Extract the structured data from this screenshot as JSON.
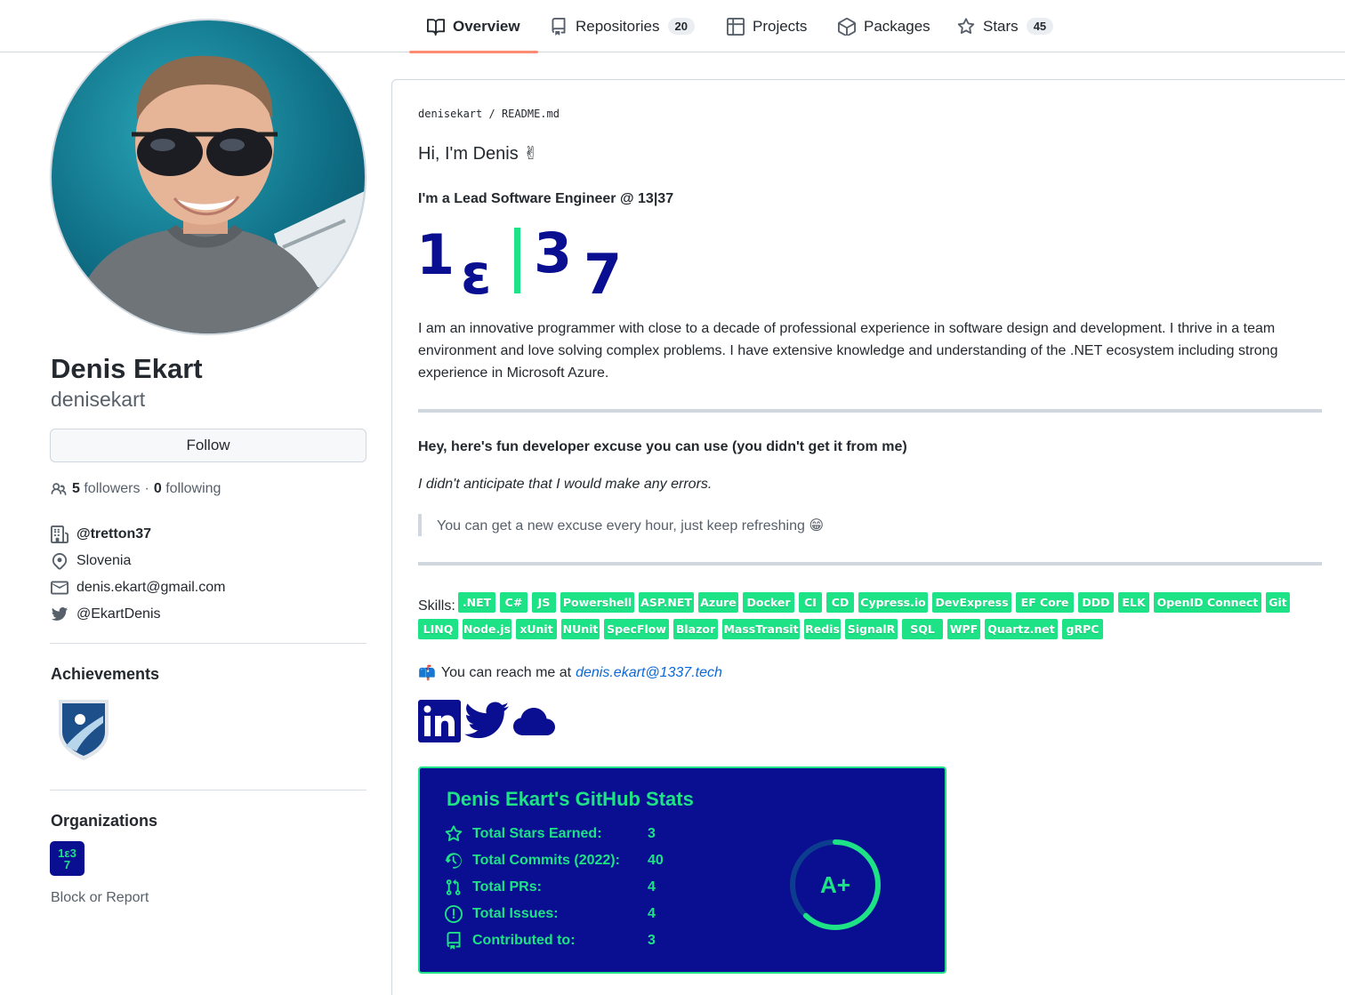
{
  "nav": {
    "tabs": [
      {
        "label": "Overview",
        "icon": "book-icon"
      },
      {
        "label": "Repositories",
        "count": "20",
        "icon": "repo-icon"
      },
      {
        "label": "Projects",
        "icon": "table-icon"
      },
      {
        "label": "Packages",
        "icon": "package-icon"
      },
      {
        "label": "Stars",
        "count": "45",
        "icon": "star-icon"
      }
    ]
  },
  "profile": {
    "name": "Denis Ekart",
    "login": "denisekart",
    "follow_label": "Follow",
    "followers_count": "5",
    "followers_label": "followers",
    "separator": "·",
    "following_count": "0",
    "following_label": "following",
    "company": "@tretton37",
    "location": "Slovenia",
    "email": "denis.ekart@gmail.com",
    "twitter": "@EkartDenis",
    "achievements_heading": "Achievements",
    "organizations_heading": "Organizations",
    "org_logo_text": "1ε37",
    "block_label": "Block or Report"
  },
  "readme": {
    "path_owner": "denisekart",
    "path_sep": "/",
    "path_file": "README.md",
    "greeting": "Hi, I'm Denis ✌",
    "role": "I'm a Lead Software Engineer @ 13|37",
    "logo_chars": [
      "1",
      "ε",
      "|",
      "3",
      "7"
    ],
    "bio": "I am an innovative programmer with close to a decade of professional experience in software design and development. I thrive in a team environment and love solving complex problems. I have extensive knowledge and understanding of the .NET ecosystem including strong experience in Microsoft Azure.",
    "excuse_heading": "Hey, here's fun developer excuse you can use (you didn't get it from me)",
    "excuse": "I didn't anticipate that I would make any errors.",
    "quote": "You can get a new excuse every hour, just keep refreshing 😁",
    "skills_label": "Skills:",
    "skills": [
      ".NET",
      "C#",
      "JS",
      "Powershell",
      "ASP.NET",
      "Azure",
      "Docker",
      "CI",
      "CD",
      "Cypress.io",
      "DevExpress",
      "EF Core",
      "DDD",
      "ELK",
      "OpenID Connect",
      "Git",
      "LINQ",
      "Node.js",
      "xUnit",
      "NUnit",
      "SpecFlow",
      "Blazor",
      "MassTransit",
      "Redis",
      "SignalR",
      "SQL",
      "WPF",
      "Quartz.net",
      "gRPC"
    ],
    "reach_emoji": "📫",
    "reach_text": "You can reach me at",
    "reach_email": "denis.ekart@1337.tech",
    "social_icons": [
      "linkedin-icon",
      "twitter-icon",
      "cloud-icon"
    ]
  },
  "stats": {
    "title": "Denis Ekart's GitHub Stats",
    "rows": [
      {
        "label": "Total Stars Earned:",
        "value": "3",
        "icon": "star-icon"
      },
      {
        "label": "Total Commits (2022):",
        "value": "40",
        "icon": "history-icon"
      },
      {
        "label": "Total PRs:",
        "value": "4",
        "icon": "pull-request-icon"
      },
      {
        "label": "Total Issues:",
        "value": "4",
        "icon": "issue-icon"
      },
      {
        "label": "Contributed to:",
        "value": "3",
        "icon": "repo-icon"
      }
    ],
    "rank": "A+",
    "rank_progress": 0.62
  },
  "colors": {
    "accent_green": "#1de286",
    "stats_bg": "#0a0f91",
    "logo_blue": "#0a0f91",
    "tab_underline": "#fd8c73",
    "link": "#0969da"
  }
}
